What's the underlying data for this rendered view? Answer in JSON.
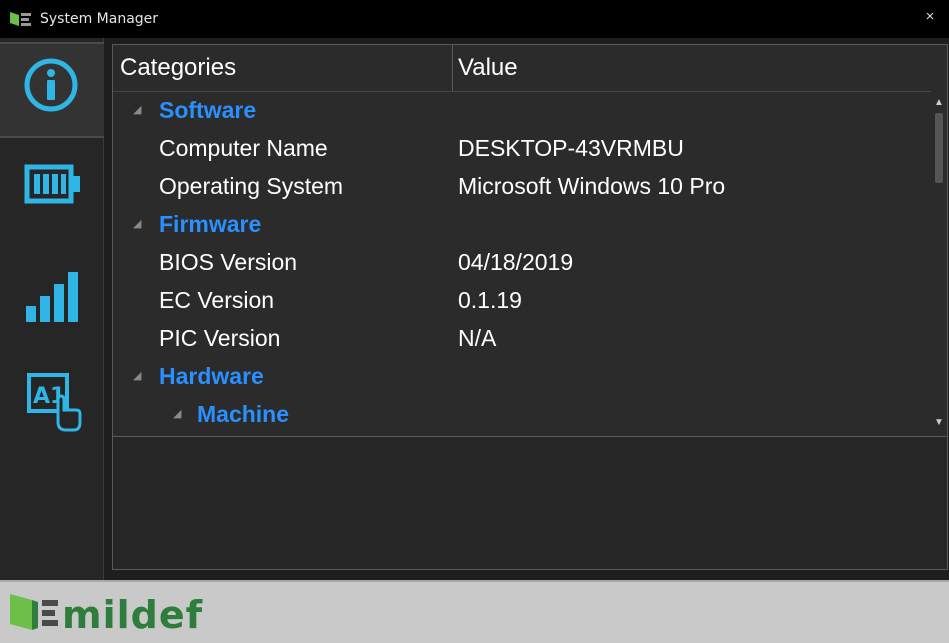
{
  "window": {
    "title": "System Manager",
    "close_label": "×",
    "icon": "mildef-app-icon"
  },
  "sidebar": {
    "items": [
      {
        "name": "info",
        "icon": "info-icon",
        "active": true
      },
      {
        "name": "battery",
        "icon": "battery-icon",
        "active": false
      },
      {
        "name": "signal",
        "icon": "signal-bars-icon",
        "active": false
      },
      {
        "name": "touch-settings",
        "icon": "touch-a1-icon",
        "active": false
      }
    ]
  },
  "table": {
    "headers": {
      "categories": "Categories",
      "value": "Value"
    },
    "rows": [
      {
        "type": "group",
        "level": 0,
        "label": "Software",
        "value": ""
      },
      {
        "type": "item",
        "level": 0,
        "label": "Computer Name",
        "value": "DESKTOP-43VRMBU"
      },
      {
        "type": "item",
        "level": 0,
        "label": "Operating System",
        "value": "Microsoft Windows 10 Pro"
      },
      {
        "type": "group",
        "level": 0,
        "label": "Firmware",
        "value": ""
      },
      {
        "type": "item",
        "level": 0,
        "label": "BIOS Version",
        "value": "04/18/2019"
      },
      {
        "type": "item",
        "level": 0,
        "label": "EC Version",
        "value": "0.1.19"
      },
      {
        "type": "item",
        "level": 0,
        "label": "PIC Version",
        "value": "N/A"
      },
      {
        "type": "group",
        "level": 0,
        "label": "Hardware",
        "value": ""
      },
      {
        "type": "group",
        "level": 1,
        "label": "Machine",
        "value": ""
      }
    ],
    "expander_glyph": "◢"
  },
  "scrollbar": {
    "up": "▲",
    "down": "▼"
  },
  "footer": {
    "brand": "mildef"
  },
  "colors": {
    "accent": "#2a8fff",
    "icon_blue": "#2fb6e6",
    "brand_green": "#6cc04a",
    "brand_dark": "#2f7d3c",
    "footer_bg": "#c9c9c9"
  }
}
